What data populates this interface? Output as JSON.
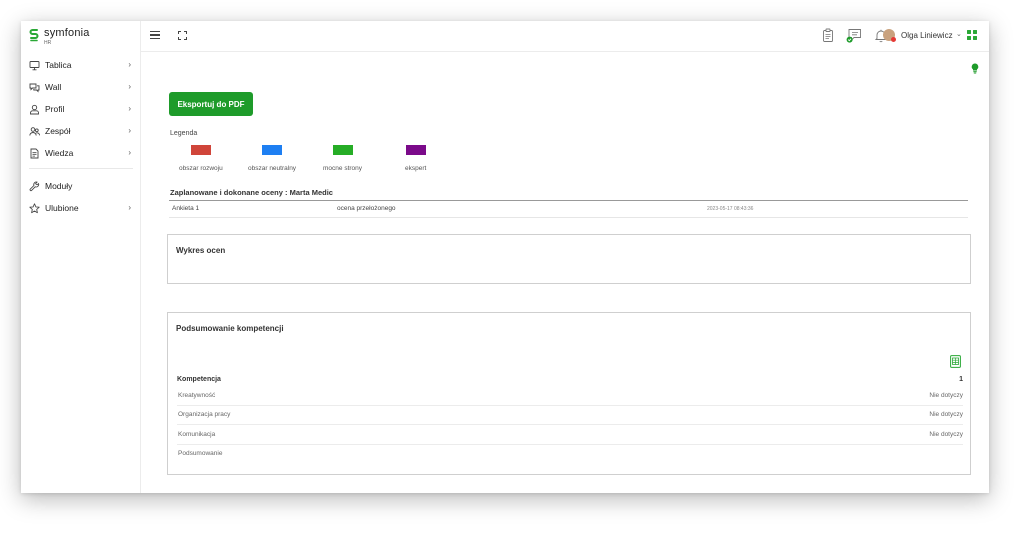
{
  "brand": {
    "name": "symfonia",
    "sub": "HR",
    "color": "#2aa836"
  },
  "sidebar": {
    "items": [
      {
        "label": "Tablica",
        "icon": "monitor-icon",
        "has_children": true
      },
      {
        "label": "Wall",
        "icon": "chat-bubbles-icon",
        "has_children": true
      },
      {
        "label": "Profil",
        "icon": "user-icon",
        "has_children": true
      },
      {
        "label": "Zespół",
        "icon": "team-icon",
        "has_children": true
      },
      {
        "label": "Wiedza",
        "icon": "document-icon",
        "has_children": true
      }
    ],
    "items2": [
      {
        "label": "Moduły",
        "icon": "wrench-icon",
        "has_children": false
      },
      {
        "label": "Ulubione",
        "icon": "star-icon",
        "has_children": true
      }
    ]
  },
  "topbar": {
    "user_name": "Olga Liniewicz",
    "icons": [
      "hamburger-icon",
      "fullscreen-icon",
      "clipboard-icon",
      "message-check-icon",
      "bell-icon",
      "apps-grid-icon"
    ]
  },
  "main": {
    "export_label": "Eksportuj do PDF",
    "legend_title": "Legenda",
    "legend": [
      {
        "label": "obszar rozwoju",
        "color": "#d0453a"
      },
      {
        "label": "obszar neutralny",
        "color": "#1e7ff2"
      },
      {
        "label": "mocne strony",
        "color": "#26ad26"
      },
      {
        "label": "ekspert",
        "color": "#7b0a8a"
      }
    ],
    "evaluations_heading": "Zaplanowane i dokonane oceny : Marta Medic",
    "evaluations": [
      {
        "name": "Ankieta 1",
        "type": "ocena przełożonego",
        "date": "2023-05-17 08:43:36"
      }
    ],
    "chart_panel_title": "Wykres ocen",
    "summary_panel_title": "Podsumowanie kompetencji",
    "competency_header": {
      "label": "Kompetencja",
      "value": "1"
    },
    "competencies": [
      {
        "label": "Kreatywność",
        "value": "Nie dotyczy"
      },
      {
        "label": "Organizacja pracy",
        "value": "Nie dotyczy"
      },
      {
        "label": "Komunikacja",
        "value": "Nie dotyczy"
      },
      {
        "label": "Podsumowanie",
        "value": ""
      }
    ]
  }
}
